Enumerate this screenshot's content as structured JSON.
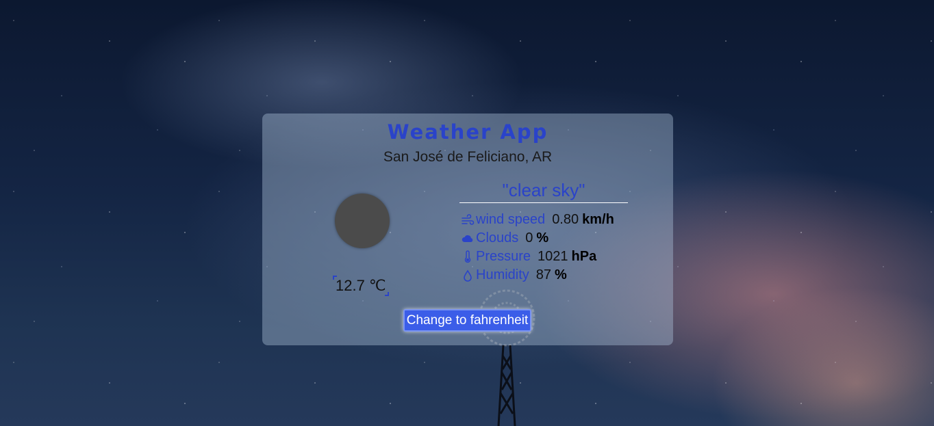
{
  "app": {
    "title": "Weather App",
    "location": "San José de Feliciano, AR"
  },
  "current": {
    "icon": "clear-sky-moon-icon",
    "temperature": "12.7 ℃",
    "description": "\"clear sky\""
  },
  "details": [
    {
      "icon": "wind-icon",
      "label": "wind speed",
      "value": "0.80",
      "unit": "km/h"
    },
    {
      "icon": "cloud-icon",
      "label": "Clouds",
      "value": "0",
      "unit": "%"
    },
    {
      "icon": "thermometer-icon",
      "label": "Pressure",
      "value": "1021",
      "unit": "hPa"
    },
    {
      "icon": "droplet-icon",
      "label": "Humidity",
      "value": "87",
      "unit": "%"
    }
  ],
  "toggle_button": {
    "label": "Change to fahrenheit"
  },
  "colors": {
    "accent": "#2a43c9",
    "button": "#3b5de8"
  }
}
